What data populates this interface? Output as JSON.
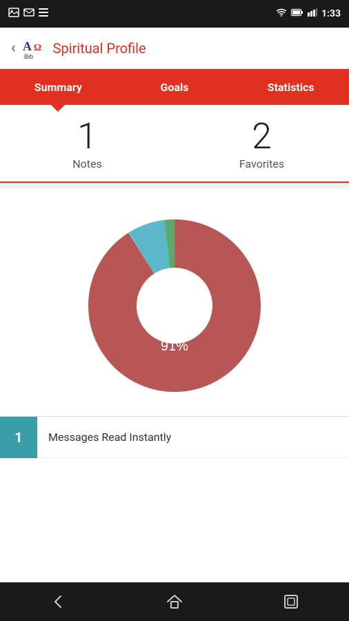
{
  "statusBar": {
    "time": "1:33",
    "icons": [
      "image",
      "email",
      "bars",
      "wifi",
      "battery",
      "signal"
    ]
  },
  "appBar": {
    "back_label": "‹",
    "title": "Spiritual Profile"
  },
  "tabs": [
    {
      "id": "summary",
      "label": "Summary",
      "active": true
    },
    {
      "id": "goals",
      "label": "Goals",
      "active": false
    },
    {
      "id": "statistics",
      "label": "Statistics",
      "active": false
    }
  ],
  "stats": [
    {
      "value": "1",
      "label": "Notes"
    },
    {
      "value": "2",
      "label": "Favorites"
    }
  ],
  "chart": {
    "percentage": "91%",
    "segments": [
      {
        "label": "main",
        "value": 91,
        "color": "#b85555"
      },
      {
        "label": "blue",
        "value": 7,
        "color": "#5bb8cc"
      },
      {
        "label": "green",
        "value": 2,
        "color": "#5caa6a"
      }
    ]
  },
  "listItems": [
    {
      "badge": "1",
      "text": "Messages Read Instantly"
    }
  ],
  "bottomNav": {
    "back_label": "back",
    "home_label": "home",
    "recents_label": "recents"
  }
}
